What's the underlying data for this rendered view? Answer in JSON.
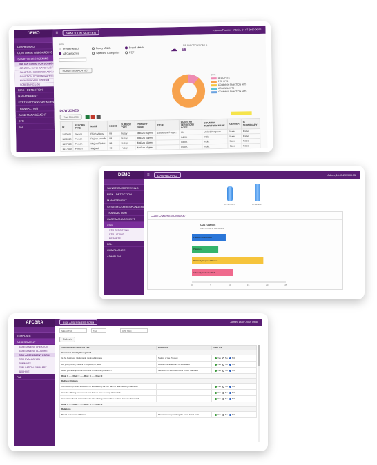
{
  "colors": {
    "brand": "#5a1e74",
    "pie_orange": "#f7a24d",
    "pie_pink": "#ee8bb3",
    "bar_blue": "#2a76d8",
    "bar_green": "#35b46b",
    "bar_yellow": "#f6c43c",
    "bar_pink": "#ef6a8d"
  },
  "s1": {
    "brand": "DEMO",
    "page_title": "SANCTION SCREEN",
    "top_right": "Admin, 14-07-2019 09:55",
    "top_user": "Admin Fournier",
    "sidebar": [
      {
        "label": "DASHBOARD"
      },
      {
        "label": "CUSTOMER ONBOARDING"
      },
      {
        "label": "SANCTION SCREENING",
        "active": true
      }
    ],
    "sidebar_subs": [
      "INSTANT SANCTION SCREEN",
      "CENTRAL BANK WATCH LIST",
      "SANCTION SCREEN BLACKLIST",
      "SANCTION SCREEN WHITELIST",
      "HIGH RISK WILL STREAM",
      "SCREENING LOG"
    ],
    "sidebar_after": [
      "RISK - DETECTION",
      "MANAGEMENT",
      "SYSTEM CORRESPONDENCE",
      "TRANSACTION",
      "CASE MANAGEMENT",
      "STR",
      "PAL"
    ],
    "filters": {
      "row1": [
        "Precise Match",
        "Fuzzy Match",
        "Broad Match"
      ],
      "row2": [
        "All Categories",
        "Selected Categories",
        "PEP"
      ],
      "search_label": "SUBMIT SEARCH KEY",
      "result_label": "Total Records"
    },
    "summary": {
      "title": "LIVE SANCTIONS CALLS",
      "value": "56"
    },
    "pie_legend": [
      {
        "label": "OFAC HITS",
        "color": "#ee8bb3"
      },
      {
        "label": "PEP HITS",
        "color": "#f7a24d"
      },
      {
        "label": "COMPANY SANCTION HITS",
        "color": "#f6c43c"
      },
      {
        "label": "CRIMINAL HITS",
        "color": "#5ec3d6"
      },
      {
        "label": "COMPANY SANCTION HITS",
        "color": "#6aa2e0"
      }
    ],
    "pie_note": "Data",
    "table_heading": "DOW JONES",
    "columns": [
      "ID",
      "RECORD TYPE",
      "NAME",
      "SCORE",
      "SUBSIDY TYPE",
      "PRIMARY NAME",
      "TITLE",
      "COUNTRY TERRITORY CODE",
      "COUNTRY TERRITORY NAME",
      "GENDER",
      "IS SUBSIDIARY"
    ],
    "rows": [
      [
        "1010011",
        "Person",
        "Elijah Vatenz",
        "99",
        "Fuzzy",
        "Mafaza Majeed",
        "Lieutenant Puasa...",
        "UK",
        "United Kingdom",
        "Male",
        "False"
      ],
      [
        "1010015",
        "Person",
        "Rajesh Ananth",
        "99",
        "Fuzzy",
        "Mafaza Majeed",
        "",
        "INDIA",
        "India",
        "Male",
        "False"
      ],
      [
        "1017003",
        "Person",
        "Majeed Rabbi",
        "99",
        "Fuzzy",
        "Mafaza Majeed",
        "",
        "INDIA",
        "India",
        "Male",
        "False"
      ],
      [
        "1017400",
        "Person",
        "Majeed",
        "99",
        "Fuzzy",
        "Mafaza Majeed",
        "",
        "INDIA",
        "India",
        "Male",
        "False"
      ]
    ]
  },
  "s2": {
    "brand": "DEMO",
    "page_title": "DASHBOARD",
    "top_right": "Admin, 14-07-2019 09:55",
    "sidebar": [
      "SANCTION SCREENING",
      "RISK - DETECTION",
      "MANAGEMENT",
      "SYSTEM CORRESPONDENCE",
      "TRANSACTION",
      "CASE MANAGEMENT",
      "STR"
    ],
    "sidebar_subs": [
      "STR REPORTING",
      "STR LISTING",
      "REPORTS"
    ],
    "sidebar_after": [
      "PAL",
      "COMPLIANCE",
      "ADMIN PAL"
    ],
    "top_dates": [
      "07-12-2017",
      "07-12-2017"
    ],
    "summary_title": "CUSTOMERS SUMMARY",
    "chart_title": "CUSTOMERS",
    "chart_subtitle": "Click on bar to see details",
    "x_ticks": [
      "0",
      "5",
      "10",
      "15",
      "20",
      "25"
    ]
  },
  "chart_data": {
    "type": "bar",
    "orientation": "horizontal",
    "categories": [
      "Pakistan Associated",
      "Pakistan",
      "Politically Exposed Person",
      "Indirectly Linked to PEP"
    ],
    "values": [
      9,
      7,
      19,
      11
    ],
    "colors": [
      "#2a76d8",
      "#35b46b",
      "#f6c43c",
      "#ef6a8d"
    ],
    "title": "CUSTOMERS",
    "xlim": [
      0,
      25
    ]
  },
  "s3": {
    "brand": "AFCBRA",
    "page_title": "RISK ASSESSMENT FORM",
    "top_right": "Admin, 14-07-2019 09:55",
    "sidebar": [
      "TEMPLATE",
      "ASSESSMENT"
    ],
    "sidebar_subs": [
      "ASSESSMENT CREATION",
      "ASSESSMENT CLOSURE",
      "RISK ASSESSMENT FORM",
      "RISK EVALUATION",
      "SUMMARY",
      "EVALUATION SUMMARY",
      "ARCHIVE"
    ],
    "sidebar_after": [
      "PAL"
    ],
    "form_fields": [
      "SELECTED",
      "TAG",
      "CPR NRC"
    ],
    "refresh": "Refresh",
    "columns": [
      "ASSESSMENT RISK OR FAIL",
      "PURPOSE",
      "APPLIED"
    ],
    "sections": [
      {
        "name": "Customer Identity Recognized",
        "rows": [
          {
            "q": "Is the business relationship involved in place",
            "p": "Nature of the Product"
          },
          {
            "q": "Do you (money) have a KYC policy in place",
            "p": "Assess the adequacy of the Board"
          },
          {
            "q": "Have you assigned the business in authority positions?",
            "p": "Members of the customer's Credit Standard"
          }
        ],
        "summary": "Risk: 0 ...... Risk: 0 ...... Risk: 0 ...... Risk: 0"
      },
      {
        "name": "Delivery Options",
        "rows": [
          {
            "q": "Can existing clients subscribe to the offering via non face to face delivery channels?",
            "p": ""
          },
          {
            "q": "Can the offering be used via non face to face delivery channels?",
            "p": ""
          },
          {
            "q": "Can initiate funds transmitted for this offering via non face to face delivery channels?",
            "p": ""
          }
        ],
        "summary": "Risk: 0 ...... Risk: 0 ...... Risk: 0 ...... Risk: 0"
      },
      {
        "name": "Relations",
        "rows": [
          {
            "q": "Broad customers affiliation",
            "p": "The customer providing the basis Fund Limit"
          }
        ],
        "summary": ""
      }
    ],
    "answers": [
      "Yes",
      "No",
      "N/A"
    ]
  }
}
